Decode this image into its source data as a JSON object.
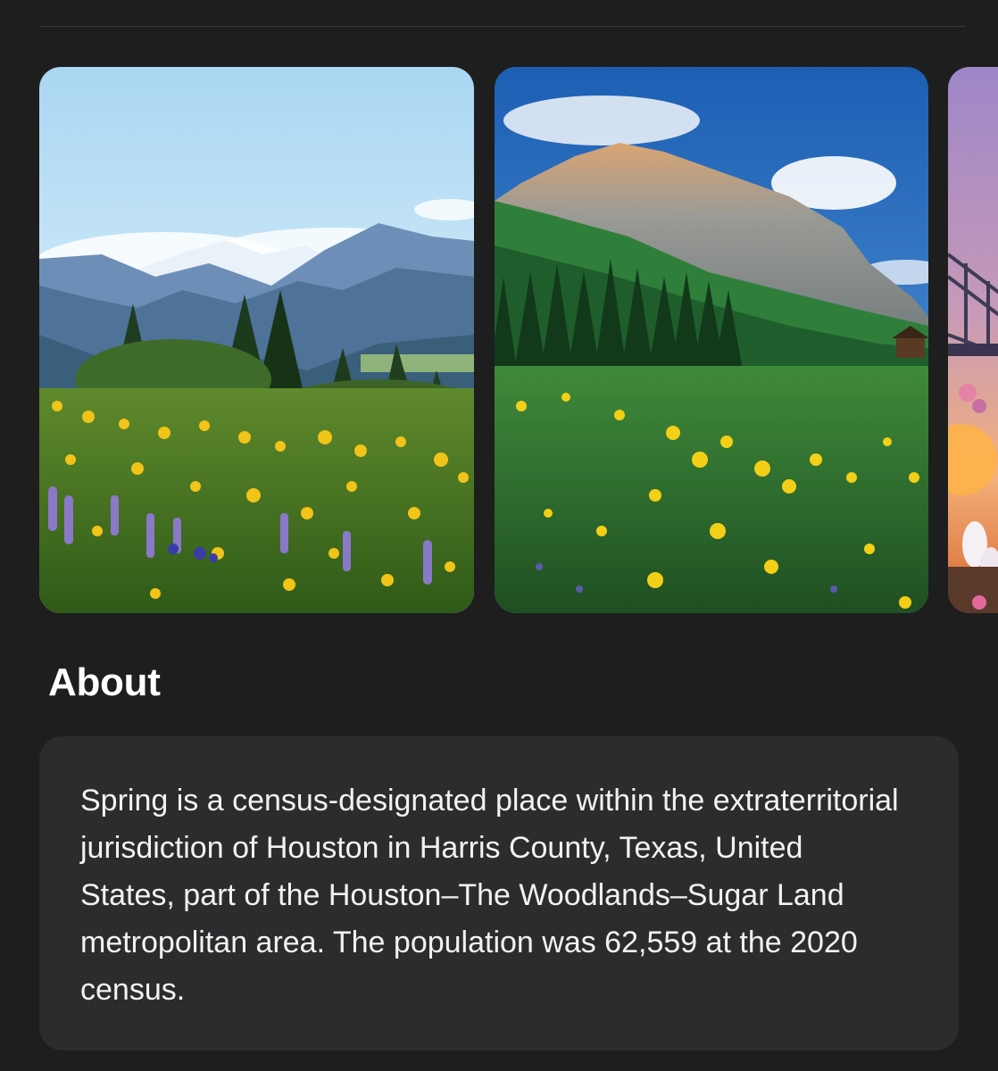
{
  "gallery": {
    "images": [
      {
        "icon": "mountain-wildflower-meadow-photo"
      },
      {
        "icon": "alpine-peak-wildflower-photo"
      },
      {
        "icon": "sunset-bridge-flowers-photo"
      }
    ]
  },
  "about": {
    "title": "About",
    "description": "Spring is a census-designated place within the extraterritorial jurisdiction of Houston in Harris County, Texas, United States, part of the Houston–The Woodlands–Sugar Land metropolitan area. The population was 62,559 at the 2020 census."
  },
  "colors": {
    "background": "#1e1e1e",
    "card": "#2c2c2e",
    "text": "#ffffff"
  }
}
